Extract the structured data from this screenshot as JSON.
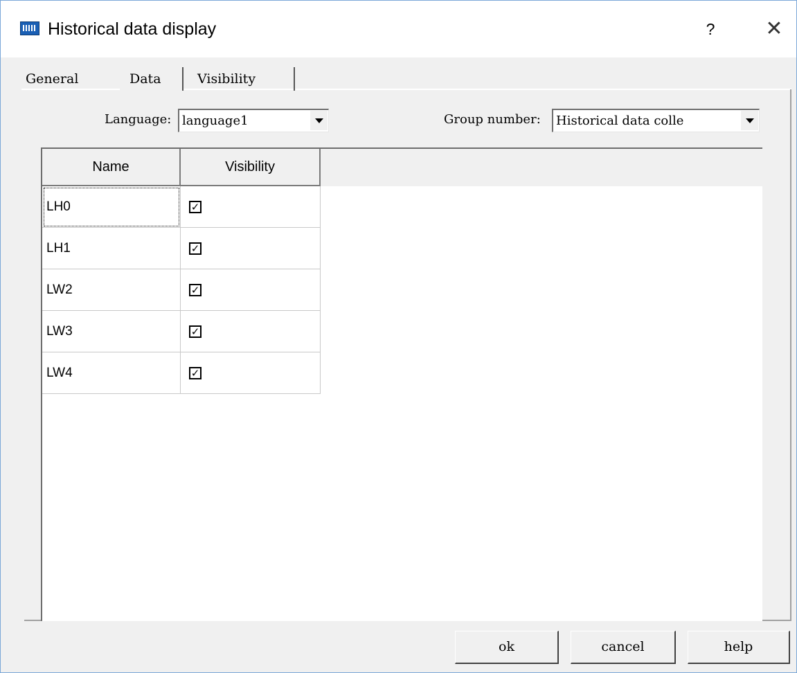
{
  "window": {
    "title": "Historical data display",
    "help_symbol": "?",
    "close_symbol": "✕",
    "icon": "hmi-app-icon"
  },
  "tabs": [
    {
      "label": "General",
      "selected": false
    },
    {
      "label": "Data",
      "selected": true
    },
    {
      "label": "Visibility",
      "selected": false
    }
  ],
  "form": {
    "language_label": "Language:",
    "language_value": "language1",
    "group_label": "Group number:",
    "group_value": "Historical data colle"
  },
  "grid": {
    "columns": [
      "Name",
      "Visibility"
    ],
    "rows": [
      {
        "name": "LH0",
        "visible": true
      },
      {
        "name": "LH1",
        "visible": true
      },
      {
        "name": "LW2",
        "visible": true
      },
      {
        "name": "LW3",
        "visible": true
      },
      {
        "name": "LW4",
        "visible": true
      }
    ],
    "check_glyph": "✓"
  },
  "buttons": {
    "ok": "ok",
    "cancel": "cancel",
    "help": "help"
  },
  "colors": {
    "dialog_bg": "#f0f0f0",
    "window_border": "#7aa7d8",
    "icon_blue": "#1a5fb4"
  }
}
